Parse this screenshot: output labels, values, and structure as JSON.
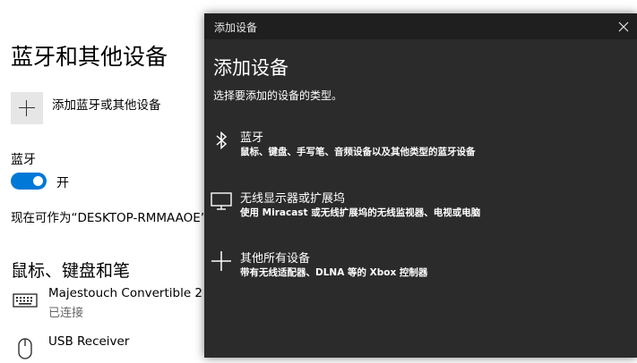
{
  "settings": {
    "title": "蓝牙和其他设备",
    "add_device_label": "添加蓝牙或其他设备",
    "bluetooth_heading": "蓝牙",
    "toggle_state": "开",
    "discoverable_text": "现在可作为“DESKTOP-RMMAAOE”被",
    "section_heading": "鼠标、键盘和笔",
    "devices": [
      {
        "name": "Majestouch Convertible 2",
        "status": "已连接",
        "icon": "keyboard-icon"
      },
      {
        "name": "USB Receiver",
        "status": "",
        "icon": "mouse-icon"
      }
    ]
  },
  "dialog": {
    "titlebar": "添加设备",
    "heading": "添加设备",
    "subtitle": "选择要添加的设备的类型。",
    "options": [
      {
        "title": "蓝牙",
        "description": "鼠标、键盘、手写笔、音频设备以及其他类型的蓝牙设备",
        "icon": "bluetooth-icon"
      },
      {
        "title": "无线显示器或扩展坞",
        "description": "使用 Miracast 或无线扩展坞的无线监视器、电视或电脑",
        "icon": "monitor-icon"
      },
      {
        "title": "其他所有设备",
        "description": "带有无线适配器、DLNA 等的 Xbox 控制器",
        "icon": "plus-icon"
      }
    ]
  },
  "colors": {
    "accent": "#0078d7",
    "dialog_bg": "#2b2b2b",
    "titlebar_bg": "#1f1f1f"
  }
}
